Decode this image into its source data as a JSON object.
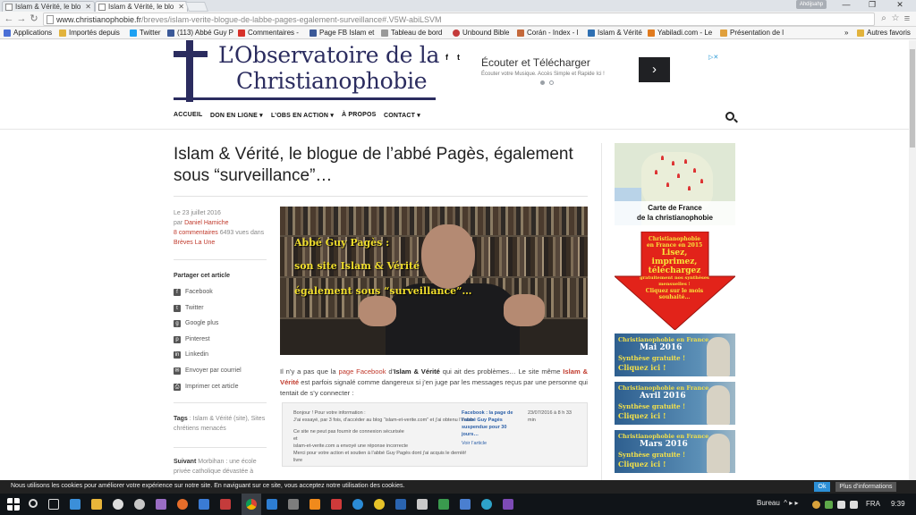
{
  "browser": {
    "tabs": [
      {
        "title": "Islam & Vérité, le blo"
      },
      {
        "title": "Islam & Vérité, le blo"
      }
    ],
    "user_badge": "Ahdijsahp",
    "url_host": "www.christianophobie.fr",
    "url_path": "/breves/islam-verite-blogue-de-labbe-pages-egalement-surveillance#.V5W-abiLSVM",
    "bookmarks": [
      {
        "label": "Applications",
        "icon": "apps-icon",
        "color": "#4a6fd6"
      },
      {
        "label": "Importés depuis",
        "icon": "folder-icon",
        "color": "#e2b33c"
      },
      {
        "label": "Twitter",
        "icon": "twitter-icon",
        "color": "#1da1f2"
      },
      {
        "label": "(113) Abbé Guy P",
        "icon": "facebook-icon",
        "color": "#3b5998"
      },
      {
        "label": "Commentaires -",
        "icon": "youtube-icon",
        "color": "#d7312a"
      },
      {
        "label": "Page FB Islam et",
        "icon": "facebook-icon",
        "color": "#3b5998"
      },
      {
        "label": "Tableau de bord",
        "icon": "page-icon",
        "color": "#999999"
      },
      {
        "label": "Unbound Bible",
        "icon": "bible-icon",
        "color": "#c43b3b"
      },
      {
        "label": "Corán - Index - l",
        "icon": "page-icon",
        "color": "#c4693b"
      },
      {
        "label": "Islam & Vérité",
        "icon": "page-icon",
        "color": "#2e6fb2"
      },
      {
        "label": "Yabiladi.com - Le",
        "icon": "yabiladi-icon",
        "color": "#e07a1d"
      },
      {
        "label": "Présentation de l",
        "icon": "page-icon",
        "color": "#e0a03c"
      }
    ],
    "bookmarks_more": "»",
    "other_favorites": "Autres favoris"
  },
  "site": {
    "logo_line1": "L’Observatoire de la",
    "logo_line2": "Christianophobie",
    "social": [
      "f",
      "t"
    ],
    "ad": {
      "title": "Écouter et Télécharger",
      "subtitle": "Écouter votre Musique. Accès Simple et Rapide Ici !",
      "button": "›",
      "choices": "▷✕"
    },
    "nav": [
      "ACCUEIL",
      "DON EN LIGNE ▾",
      "L’OBS EN ACTION ▾",
      "À PROPOS",
      "CONTACT ▾"
    ]
  },
  "article": {
    "title": "Islam & Vérité, le blogue de l’abbé Pagès, également sous “surveillance”…",
    "date": "Le 23 juillet 2016",
    "by": "par",
    "author": "Daniel Hamiche",
    "comments": "8 commentaires",
    "views": "6493 vues dans",
    "category": "Brèves La Une",
    "share_title": "Partager cet article",
    "share": [
      {
        "label": "Facebook",
        "icon": "facebook-icon"
      },
      {
        "label": "Twitter",
        "icon": "twitter-icon"
      },
      {
        "label": "Google plus",
        "icon": "google-plus-icon"
      },
      {
        "label": "Pinterest",
        "icon": "pinterest-icon"
      },
      {
        "label": "Linkedin",
        "icon": "linkedin-icon"
      },
      {
        "label": "Envoyer par courriel",
        "icon": "mail-icon"
      },
      {
        "label": "Imprimer cet article",
        "icon": "print-icon"
      }
    ],
    "tags_label": "Tags",
    "tags": "Islam & Vérité (site), Sites chrétiens menacés",
    "next_label": "Suivant",
    "next_text": "Morbihan : une école privée catholique dévastée à",
    "hero_lines": [
      "Abbé Guy Pagès :",
      "son site Islam & Vérité",
      "également sous “surveillance”…"
    ],
    "intro_1": "Il n’y a pas que la ",
    "intro_link": "page Facebook",
    "intro_2": " d’",
    "intro_bold": "Islam & Vérité",
    "intro_3": " qui ait des problèmes… Le site même ",
    "intro_bold_red": "Islam & Vérité",
    "intro_4": " est parfois signalé comme dangereux si j’en juge par les messages reçus par une personne qui tentait de s’y connecter :",
    "inset_left": [
      "Bonjour ! Pour votre information :",
      "J’ai essayé, par 3 fois, d’accéder au blog “islam-et-verite.com” et j’ai obtenu l’écran",
      "",
      "Ce site ne peut pas fournir de connexion sécurisée",
      "et",
      "islam-et-verite.com a envoyé une réponse incorrecte",
      "Merci pour votre action et soutien à l’abbé Guy Pagès dont j’ai acquis le dernier",
      "livre"
    ],
    "inset_link_lines": [
      "Facebook : la page de",
      "l’abbé Guy Pagès",
      "suspendue pour 30",
      "jours…"
    ],
    "inset_view": "Voir l’article",
    "inset_dots": "…",
    "inset_date": "23/07/2016 à 8 h 33",
    "inset_min": "min"
  },
  "sidebar": {
    "map_caption_1": "Carte de France",
    "map_caption_2": "de la christianophobie",
    "arrow_lines": [
      "Christianophobie",
      "en France en 2015",
      "Lisez,",
      "imprimez,",
      "téléchargez",
      "gratuitement nos synthèses mensuelles !",
      "Cliquez sur le mois",
      "souhaité…"
    ],
    "banners": [
      {
        "title": "Christianophobie en France",
        "month": "Mai 2016",
        "l1": "Synthèse gratuite !",
        "l2": "Cliquez ici !"
      },
      {
        "title": "Christianophobie en France",
        "month": "Avril 2016",
        "l1": "Synthèse gratuite !",
        "l2": "Cliquez ici !"
      },
      {
        "title": "Christianophobie en France",
        "month": "Mars 2016",
        "l1": "Synthèse gratuite !",
        "l2": "Cliquez ici !"
      }
    ]
  },
  "cookie": {
    "text": "Nous utilisons les cookies pour améliorer votre expérience sur notre site. En naviguant sur ce site, vous acceptez notre utilisation des cookies.",
    "ok": "Ok",
    "more": "Plus d’informations"
  },
  "taskbar": {
    "tray_label": "Bureau",
    "tray_arrows": "^ ▸ ▸",
    "lang": "FRA",
    "time": "9:39"
  },
  "colors": {
    "brand": "#2b2c5f",
    "link": "#c0392b",
    "hero_text": "#f0de2c"
  }
}
